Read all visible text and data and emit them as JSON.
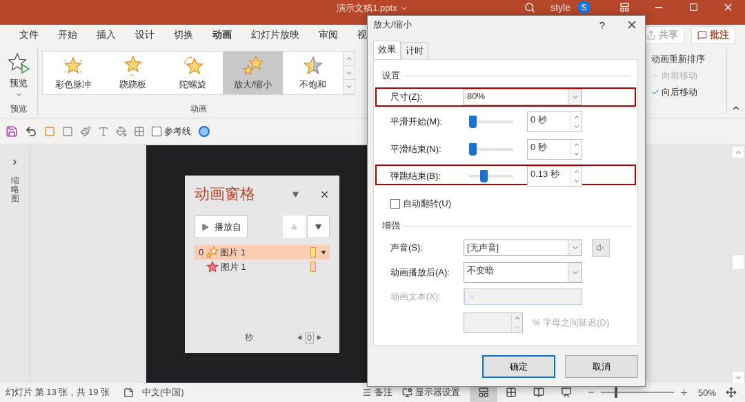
{
  "window": {
    "title": "演示文稿1.pptx",
    "user": "style",
    "avatar": "S"
  },
  "ribbon_tabs": [
    {
      "label": "文件",
      "selected": false
    },
    {
      "label": "开始",
      "selected": false
    },
    {
      "label": "插入",
      "selected": false
    },
    {
      "label": "设计",
      "selected": false
    },
    {
      "label": "切换",
      "selected": false
    },
    {
      "label": "动画",
      "selected": true
    },
    {
      "label": "幻灯片放映",
      "selected": false
    },
    {
      "label": "审阅",
      "selected": false
    },
    {
      "label": "视",
      "selected": false
    }
  ],
  "share_button": "共享",
  "comment_button": "批注",
  "preview_group": {
    "button": "预览",
    "label": "预览"
  },
  "animation_gallery": {
    "label": "动画",
    "items": [
      {
        "label": "彩色脉冲",
        "selected": false
      },
      {
        "label": "跷跷板",
        "selected": false
      },
      {
        "label": "陀螺旋",
        "selected": false
      },
      {
        "label": "放大/缩小",
        "selected": true
      },
      {
        "label": "不饱和",
        "selected": false
      }
    ]
  },
  "reorder_group": {
    "title": "动画重新排序",
    "items": [
      {
        "label": "向前移动",
        "disabled": true
      },
      {
        "label": "向后移动",
        "disabled": false
      }
    ]
  },
  "quick_toolbar": {
    "guides": {
      "label": "参考线",
      "checked": false
    }
  },
  "thumbnail_pane": {
    "label": "缩略图"
  },
  "animation_pane": {
    "title": "动画窗格",
    "play_button": "播放自",
    "items": [
      {
        "order": "0",
        "label": "图片 1",
        "selected": true,
        "color": "#ffe07a"
      },
      {
        "label": "图片 1",
        "selected": false,
        "color": "#ffc8c8"
      }
    ],
    "time_unit": "秒",
    "timeline_value": "0"
  },
  "dialog": {
    "title": "放大/缩小",
    "help": "?",
    "tabs": [
      {
        "label": "效果",
        "selected": true
      },
      {
        "label": "计时",
        "selected": false
      }
    ],
    "sections": [
      {
        "title": "设置",
        "rows": [
          {
            "kind": "combo",
            "label": "尺寸(Z):",
            "value": "80%",
            "highlighted": true
          },
          {
            "kind": "slider",
            "label": "平滑开始(M):",
            "level": 0,
            "value": "0 秒",
            "highlighted": false
          },
          {
            "kind": "slider",
            "label": "平滑结束(N):",
            "level": 0,
            "value": "0 秒",
            "highlighted": false
          },
          {
            "kind": "slider",
            "label": "弹跳结束(B):",
            "level": 0.3,
            "value": "0.13 秒",
            "highlighted": true
          },
          {
            "kind": "checkbox",
            "label": "自动翻转(U)",
            "checked": false
          }
        ]
      },
      {
        "title": "增强",
        "rows": [
          {
            "kind": "sound",
            "label": "声音(S):",
            "value": "[无声音]",
            "disabled": false
          },
          {
            "kind": "combo",
            "label": "动画播放后(A):",
            "value": "不变暗",
            "disabled": false,
            "tall": true
          },
          {
            "kind": "combo",
            "label": "动画文本(X):",
            "disabled": true
          },
          {
            "kind": "spin",
            "suffix": "% 字母之间延迟(D)",
            "disabled": true
          }
        ]
      }
    ],
    "buttons": [
      {
        "label": "确定",
        "default": true
      },
      {
        "label": "取消",
        "default": false
      }
    ]
  },
  "status_bar": {
    "slide_info": "幻灯片 第 13 张，共 19 张",
    "language": "中文(中国)",
    "notes": "备注",
    "display_settings": "显示器设置",
    "views": [
      {
        "selected": true
      },
      {
        "selected": false
      },
      {
        "selected": false
      },
      {
        "selected": false
      }
    ],
    "zoom": {
      "level": 0.2,
      "value": "50%"
    }
  }
}
